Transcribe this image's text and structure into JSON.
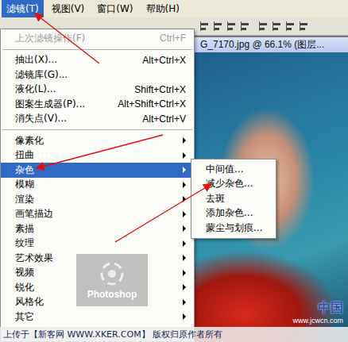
{
  "menubar": [
    {
      "label": "滤镜(T)",
      "selected": true
    },
    {
      "label": "视图(V)",
      "selected": false
    },
    {
      "label": "窗口(W)",
      "selected": false
    },
    {
      "label": "帮助(H)",
      "selected": false
    }
  ],
  "document": {
    "title": "G_7170.jpg @ 66.1% (图层..."
  },
  "menu": [
    {
      "kind": "command",
      "label": "上次滤镜操作(F)",
      "shortcut": "Ctrl+F",
      "disabled": true,
      "selected": false
    },
    {
      "kind": "separator"
    },
    {
      "kind": "command",
      "label": "抽出(X)...",
      "shortcut": "Alt+Ctrl+X",
      "disabled": false,
      "selected": false
    },
    {
      "kind": "command",
      "label": "滤镜库(G)...",
      "shortcut": "",
      "disabled": false,
      "selected": false
    },
    {
      "kind": "command",
      "label": "液化(L)...",
      "shortcut": "Shift+Ctrl+X",
      "disabled": false,
      "selected": false
    },
    {
      "kind": "command",
      "label": "图案生成器(P)...",
      "shortcut": "Alt+Shift+Ctrl+X",
      "disabled": false,
      "selected": false
    },
    {
      "kind": "command",
      "label": "消失点(V)...",
      "shortcut": "Alt+Ctrl+V",
      "disabled": false,
      "selected": false
    },
    {
      "kind": "separator"
    },
    {
      "kind": "submenu",
      "label": "像素化",
      "disabled": false,
      "selected": false
    },
    {
      "kind": "submenu",
      "label": "扭曲",
      "disabled": false,
      "selected": false
    },
    {
      "kind": "submenu",
      "label": "杂色",
      "disabled": false,
      "selected": true
    },
    {
      "kind": "submenu",
      "label": "模糊",
      "disabled": false,
      "selected": false
    },
    {
      "kind": "submenu",
      "label": "渲染",
      "disabled": false,
      "selected": false
    },
    {
      "kind": "submenu",
      "label": "画笔描边",
      "disabled": false,
      "selected": false
    },
    {
      "kind": "submenu",
      "label": "素描",
      "disabled": false,
      "selected": false
    },
    {
      "kind": "submenu",
      "label": "纹理",
      "disabled": false,
      "selected": false
    },
    {
      "kind": "submenu",
      "label": "艺术效果",
      "disabled": false,
      "selected": false
    },
    {
      "kind": "submenu",
      "label": "视频",
      "disabled": false,
      "selected": false
    },
    {
      "kind": "submenu",
      "label": "锐化",
      "disabled": false,
      "selected": false
    },
    {
      "kind": "submenu",
      "label": "风格化",
      "disabled": false,
      "selected": false
    },
    {
      "kind": "submenu",
      "label": "其它",
      "disabled": false,
      "selected": false
    },
    {
      "kind": "separator"
    }
  ],
  "submenu": [
    {
      "label": "中间值...",
      "selected": false
    },
    {
      "label": "减少杂色...",
      "selected": false
    },
    {
      "label": "去斑",
      "selected": false
    },
    {
      "label": "添加杂色...",
      "selected": false
    },
    {
      "label": "蒙尘与划痕...",
      "selected": false
    }
  ],
  "watermarks": {
    "logo": "Photoshop",
    "site": "中国",
    "url": "www.jcwcn.com",
    "caption": "上传于【新客网 WWW.XKER.COM】 版权归原作者所有"
  }
}
